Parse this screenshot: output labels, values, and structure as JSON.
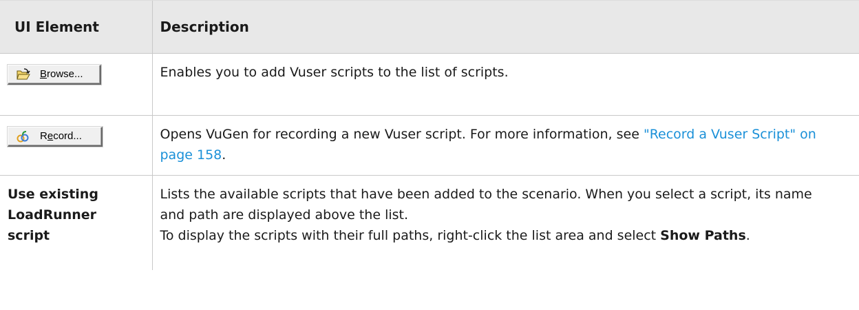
{
  "table": {
    "headers": [
      "UI Element",
      "Description"
    ],
    "rows": [
      {
        "element": {
          "type": "button",
          "icon": "open-folder-icon",
          "label_pre": "",
          "label_ul": "B",
          "label_post": "rowse..."
        },
        "description": "Enables you to add Vuser scripts to the list of scripts."
      },
      {
        "element": {
          "type": "button",
          "icon": "record-script-icon",
          "label_pre": "R",
          "label_ul": "e",
          "label_post": "cord..."
        },
        "description_pre": "Opens VuGen for recording a new Vuser script. For more information, see ",
        "link": "\"Record a Vuser Script\" on page 158",
        "description_post": "."
      },
      {
        "element": {
          "type": "text",
          "label": "Use existing LoadRunner script"
        },
        "description_p1": "Lists the available scripts that have been added to the scenario. When you select a script, its name and path are displayed above the list.",
        "description_p2_pre": "To display the scripts with their full paths, right-click the list area and select ",
        "description_p2_bold": "Show Paths",
        "description_p2_post": "."
      }
    ]
  },
  "colors": {
    "header_bg": "#e8e8e8",
    "link": "#1a90d8",
    "border": "#c8c8c8"
  }
}
